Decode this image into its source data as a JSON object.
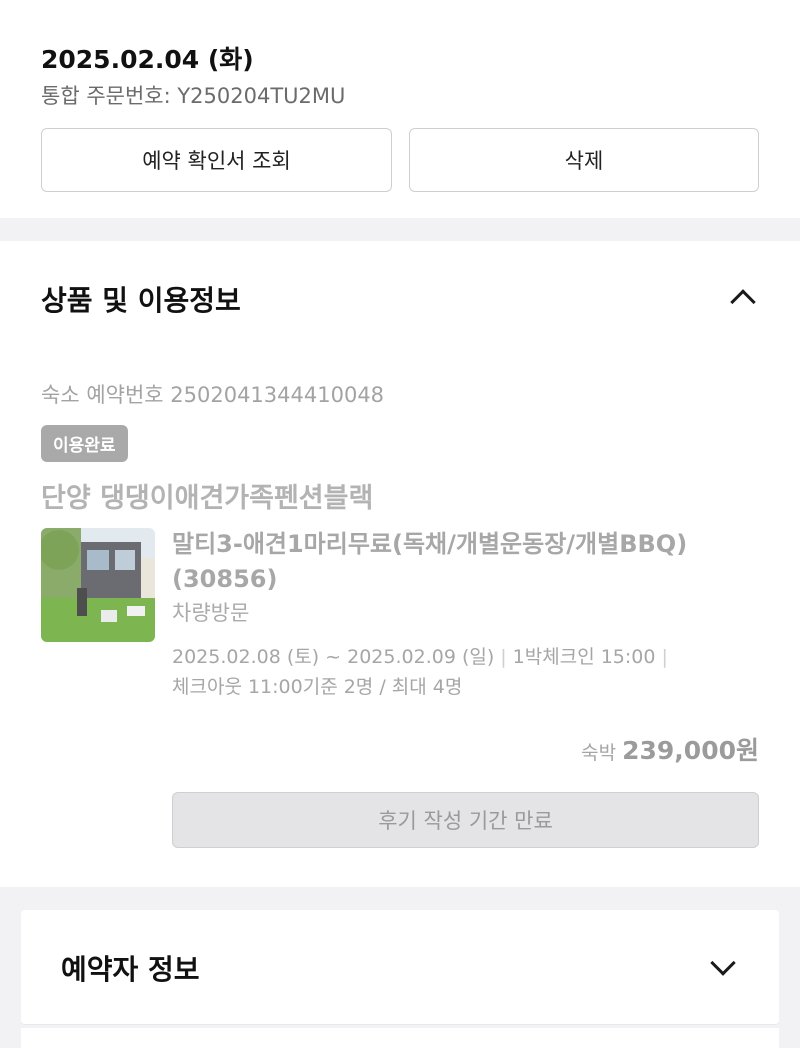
{
  "order": {
    "date": "2025.02.04 (화)",
    "number_text": "통합 주문번호: Y250204TU2MU",
    "confirm_button": "예약 확인서 조회",
    "delete_button": "삭제"
  },
  "product_section": {
    "title": "상품 및 이용정보",
    "reservation_no": "숙소 예약번호 2502041344410048",
    "status_badge": "이용완료",
    "hotel_name": "단양 댕댕이애견가족펜션블랙",
    "room_name": "말티3-애견1마리무료(독채/개별운동장/개별BBQ)(30856)",
    "visit_type": "차량방문",
    "stay_dates": "2025.02.08 (토) ~ 2025.02.09 (일)",
    "nights_checkin": "1박체크인 15:00",
    "checkout_guests": "체크아웃 11:00기준 2명 / 최대 4명",
    "price_label": "숙박",
    "price": "239,000원",
    "review_button": "후기 작성 기간 만료"
  },
  "booker_section": {
    "title": "예약자 정보"
  },
  "icons": {
    "collapse": "chevron-up-icon",
    "expand": "chevron-down-icon"
  },
  "colors": {
    "badge_bg": "#a9a9a9",
    "page_bg": "#f2f2f4"
  }
}
